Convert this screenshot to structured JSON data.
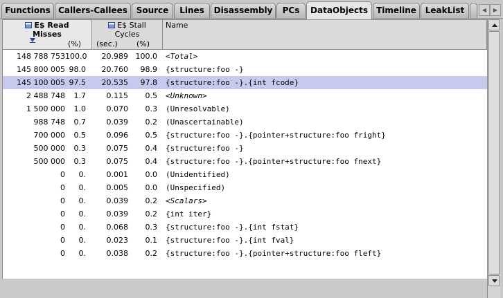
{
  "tabs": [
    {
      "label": "Functions",
      "active": false
    },
    {
      "label": "Callers-Callees",
      "active": false
    },
    {
      "label": "Source",
      "active": false
    },
    {
      "label": "Lines",
      "active": false
    },
    {
      "label": "Disassembly",
      "active": false
    },
    {
      "label": "PCs",
      "active": false
    },
    {
      "label": "DataObjects",
      "active": true
    },
    {
      "label": "Timeline",
      "active": false
    },
    {
      "label": "LeakList",
      "active": false
    }
  ],
  "tab_scroll": {
    "left_icon": "arrow-left-icon",
    "right_icon": "arrow-right-icon"
  },
  "columns": {
    "misses": {
      "line1": "E$ Read",
      "line2": "Misses",
      "unit_pct": "(%)",
      "icon": "metric-icon",
      "sort_icon": "sort-descending-icon"
    },
    "stall": {
      "line1": "E$ Stall",
      "line2": "Cycles",
      "unit_sec": "(sec.)",
      "unit_pct": "(%)",
      "icon": "metric-icon"
    },
    "name": {
      "label": "Name"
    }
  },
  "rows": [
    {
      "misses": "148 788 753",
      "misses_pct": "100.0",
      "stall": "20.989",
      "stall_pct": "100.0",
      "name": "<Total>",
      "italic": true,
      "selected": false
    },
    {
      "misses": "145 800 005",
      "misses_pct": "98.0",
      "stall": "20.760",
      "stall_pct": "98.9",
      "name": "{structure:foo -}",
      "italic": false,
      "selected": false
    },
    {
      "misses": "145 100 005",
      "misses_pct": "97.5",
      "stall": "20.535",
      "stall_pct": "97.8",
      "name": "{structure:foo -}.{int fcode}",
      "italic": false,
      "selected": true
    },
    {
      "misses": "2 488 748",
      "misses_pct": "1.7",
      "stall": "0.115",
      "stall_pct": "0.5",
      "name": "<Unknown>",
      "italic": true,
      "selected": false
    },
    {
      "misses": "1 500 000",
      "misses_pct": "1.0",
      "stall": "0.070",
      "stall_pct": "0.3",
      "name": "(Unresolvable)",
      "italic": false,
      "selected": false
    },
    {
      "misses": "988 748",
      "misses_pct": "0.7",
      "stall": "0.039",
      "stall_pct": "0.2",
      "name": "(Unascertainable)",
      "italic": false,
      "selected": false
    },
    {
      "misses": "700 000",
      "misses_pct": "0.5",
      "stall": "0.096",
      "stall_pct": "0.5",
      "name": "{structure:foo -}.{pointer+structure:foo fright}",
      "italic": false,
      "selected": false
    },
    {
      "misses": "500 000",
      "misses_pct": "0.3",
      "stall": "0.075",
      "stall_pct": "0.4",
      "name": "{structure:foo -}",
      "italic": false,
      "selected": false
    },
    {
      "misses": "500 000",
      "misses_pct": "0.3",
      "stall": "0.075",
      "stall_pct": "0.4",
      "name": "{structure:foo -}.{pointer+structure:foo fnext}",
      "italic": false,
      "selected": false
    },
    {
      "misses": "0",
      "misses_pct": "0.",
      "stall": "0.001",
      "stall_pct": "0.0",
      "name": "(Unidentified)",
      "italic": false,
      "selected": false
    },
    {
      "misses": "0",
      "misses_pct": "0.",
      "stall": "0.005",
      "stall_pct": "0.0",
      "name": "(Unspecified)",
      "italic": false,
      "selected": false
    },
    {
      "misses": "0",
      "misses_pct": "0.",
      "stall": "0.039",
      "stall_pct": "0.2",
      "name": "<Scalars>",
      "italic": true,
      "selected": false
    },
    {
      "misses": "0",
      "misses_pct": "0.",
      "stall": "0.039",
      "stall_pct": "0.2",
      "name": "{int iter}",
      "italic": false,
      "selected": false
    },
    {
      "misses": "0",
      "misses_pct": "0.",
      "stall": "0.068",
      "stall_pct": "0.3",
      "name": "{structure:foo -}.{int fstat}",
      "italic": false,
      "selected": false
    },
    {
      "misses": "0",
      "misses_pct": "0.",
      "stall": "0.023",
      "stall_pct": "0.1",
      "name": "{structure:foo -}.{int fval}",
      "italic": false,
      "selected": false
    },
    {
      "misses": "0",
      "misses_pct": "0.",
      "stall": "0.038",
      "stall_pct": "0.2",
      "name": "{structure:foo -}.{pointer+structure:foo fleft}",
      "italic": false,
      "selected": false
    }
  ],
  "colors": {
    "selection": "#c7c9ee",
    "chrome": "#c9c9c9",
    "metric_icon": "#2b49a3"
  }
}
